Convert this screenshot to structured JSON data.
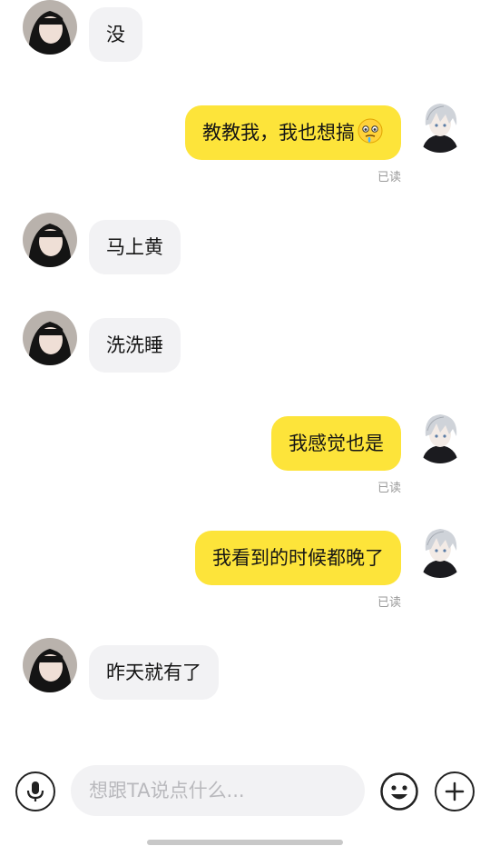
{
  "messages": [
    {
      "side": "in",
      "text": "没",
      "read_label": ""
    },
    {
      "side": "out",
      "text": "教教我，我也想搞",
      "emoji": "drooling-face-icon",
      "read_label": "已读"
    },
    {
      "side": "in",
      "text": "马上黄",
      "read_label": ""
    },
    {
      "side": "in",
      "text": "洗洗睡",
      "read_label": ""
    },
    {
      "side": "out",
      "text": "我感觉也是",
      "read_label": "已读"
    },
    {
      "side": "out",
      "text": "我看到的时候都晚了",
      "read_label": "已读"
    },
    {
      "side": "in",
      "text": "昨天就有了",
      "read_label": ""
    }
  ],
  "input_bar": {
    "placeholder": "想跟TA说点什么...",
    "value": "",
    "left_icon": "microphone-icon",
    "emoji_icon": "smiley-face-icon",
    "plus_icon": "plus-icon"
  },
  "colors": {
    "outgoing_bubble": "#fde43a",
    "incoming_bubble": "#f2f2f4",
    "read_receipt": "#9a9a9a"
  }
}
